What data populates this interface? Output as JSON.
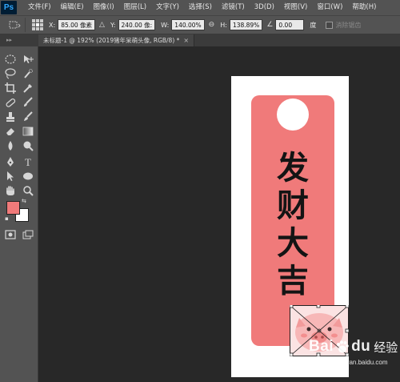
{
  "app": {
    "logo": "Ps",
    "menu": [
      "文件(F)",
      "编辑(E)",
      "图像(I)",
      "图层(L)",
      "文字(Y)",
      "选择(S)",
      "滤镜(T)",
      "3D(D)",
      "视图(V)",
      "窗口(W)",
      "帮助(H)"
    ]
  },
  "options": {
    "x_label": "X:",
    "x_value": "85.00 像素",
    "y_label": "Y:",
    "y_value": "240.00 像:",
    "w_label": "W:",
    "w_value": "140.00%",
    "h_label": "H:",
    "h_value": "138.89%",
    "angle_value": "0.00",
    "angle_unit": "度",
    "antialias_label": "消除锯齿"
  },
  "document": {
    "tab_title": "未标题-1 @ 192% (2019猪年呆萌头像, RGB/8) *",
    "tab_close": "×",
    "tag_text": [
      "发",
      "财",
      "大",
      "吉"
    ],
    "tag_color": "#f07a7a"
  },
  "colors": {
    "foreground": "#f07a7a",
    "background": "#ffffff"
  },
  "watermark": {
    "brand_left": "Bai",
    "brand_right": "du",
    "brand_cn": "经验",
    "url": "jingyan.baidu.com"
  }
}
